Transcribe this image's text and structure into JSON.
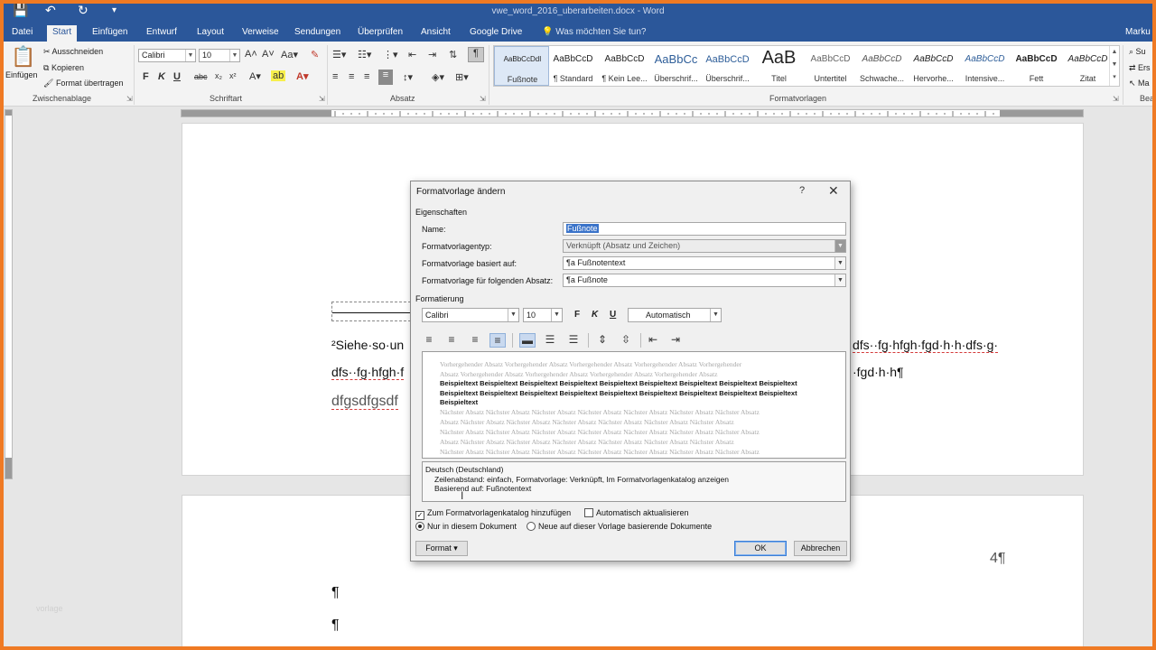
{
  "titlebar": {
    "save_icon": "💾",
    "undo_icon": "↶",
    "redo_icon": "↻",
    "customize_icon": "▾",
    "document_title": "vwe_word_2016_uberarbeiten.docx - Word"
  },
  "tabs": [
    {
      "label": "Datei"
    },
    {
      "label": "Start"
    },
    {
      "label": "Einfügen"
    },
    {
      "label": "Entwurf"
    },
    {
      "label": "Layout"
    },
    {
      "label": "Verweise"
    },
    {
      "label": "Sendungen"
    },
    {
      "label": "Überprüfen"
    },
    {
      "label": "Ansicht"
    },
    {
      "label": "Google Drive"
    },
    {
      "label": "Was möchten Sie tun?"
    },
    {
      "label": "Marku"
    }
  ],
  "ribbon": {
    "clipboard": {
      "paste_label": "Einfügen",
      "cut_label": "Ausschneiden",
      "copy_label": "Kopieren",
      "format_painter_label": "Format übertragen",
      "group_label": "Zwischenablage"
    },
    "font": {
      "font_name": "Calibri",
      "font_size": "10",
      "group_label": "Schriftart"
    },
    "paragraph": {
      "group_label": "Absatz"
    },
    "styles": {
      "group_label": "Formatvorlagen",
      "items": [
        {
          "preview": "AaBbCcDdI",
          "name": "Fußnote"
        },
        {
          "preview": "AaBbCcD",
          "name": "¶ Standard"
        },
        {
          "preview": "AaBbCcD",
          "name": "¶ Kein Lee..."
        },
        {
          "preview": "AaBbCc",
          "name": "Überschrif..."
        },
        {
          "preview": "AaBbCcD",
          "name": "Überschrif..."
        },
        {
          "preview": "AaB",
          "name": "Titel"
        },
        {
          "preview": "AaBbCcD",
          "name": "Untertitel"
        },
        {
          "preview": "AaBbCcD",
          "name": "Schwache..."
        },
        {
          "preview": "AaBbCcD",
          "name": "Hervorhe..."
        },
        {
          "preview": "AaBbCcD",
          "name": "Intensive..."
        },
        {
          "preview": "AaBbCcD",
          "name": "Fett"
        },
        {
          "preview": "AaBbCcD",
          "name": "Zitat"
        }
      ]
    },
    "editing": {
      "search_label": "Su",
      "replace_label": "Ers",
      "select_label": "Ma",
      "group_label": "Bea"
    }
  },
  "document": {
    "line1_start": "²Siehe·so·un",
    "line1_end": "dfs··fg·hfgh·fgd·h·h·dfs·g·",
    "line2_start": "dfs··fg·hfgh·f",
    "line2_end": "·fgd·h·h¶",
    "line3_start": "dfgsdfgsdf",
    "page_number": "4¶",
    "para_mark_1": "¶",
    "para_mark_2": "¶",
    "watermark": "vorlage"
  },
  "dialog": {
    "title": "Formatvorlage ändern",
    "help_label": "?",
    "close_label": "✕",
    "properties_heading": "Eigenschaften",
    "name_label": "Name:",
    "name_value": "Fußnote",
    "type_label": "Formatvorlagentyp:",
    "type_value": "Verknüpft (Absatz und Zeichen)",
    "based_on_label": "Formatvorlage basiert auf:",
    "based_on_value": "¶a Fußnotentext",
    "next_label": "Formatvorlage für folgenden Absatz:",
    "next_value": "¶a Fußnote",
    "formatting_heading": "Formatierung",
    "font_name": "Calibri",
    "font_size": "10",
    "bold_label": "F",
    "italic_label": "K",
    "underline_label": "U",
    "color_value": "Automatisch",
    "preview": {
      "previous": [
        "Vorhergehender Absatz Vorhergehender Absatz Vorhergehender Absatz Vorhergehender Absatz Vorhergehender",
        "Absatz Vorhergehender Absatz Vorhergehender Absatz Vorhergehender Absatz Vorhergehender Absatz"
      ],
      "sample": [
        "Beispieltext Beispieltext Beispieltext Beispieltext Beispieltext Beispieltext Beispieltext Beispieltext Beispieltext",
        "Beispieltext Beispieltext Beispieltext Beispieltext Beispieltext Beispieltext Beispieltext Beispieltext Beispieltext",
        "Beispieltext"
      ],
      "next": [
        "Nächster Absatz Nächster Absatz Nächster Absatz Nächster Absatz Nächster Absatz Nächster Absatz Nächster Absatz",
        "Absatz Nächster Absatz Nächster Absatz Nächster Absatz Nächster Absatz Nächster Absatz Nächster Absatz",
        "Nächster Absatz Nächster Absatz Nächster Absatz Nächster Absatz Nächster Absatz Nächster Absatz Nächster Absatz",
        "Absatz Nächster Absatz Nächster Absatz Nächster Absatz Nächster Absatz Nächster Absatz Nächster Absatz",
        "Nächster Absatz Nächster Absatz Nächster Absatz Nächster Absatz Nächster Absatz Nächster Absatz Nächster Absatz"
      ]
    },
    "description": {
      "line1": "Deutsch (Deutschland)",
      "line2": "Zeilenabstand:  einfach, Formatvorlage: Verknüpft, Im Formatvorlagenkatalog anzeigen",
      "line3": "Basierend auf: Fußnotentext"
    },
    "add_to_gallery_label": "Zum Formatvorlagenkatalog hinzufügen",
    "add_to_gallery_checked": true,
    "auto_update_label": "Automatisch aktualisieren",
    "auto_update_checked": false,
    "only_this_document_label": "Nur in diesem Dokument",
    "new_documents_label": "Neue auf dieser Vorlage basierende Dokumente",
    "format_button_label": "Format ▾",
    "ok_label": "OK",
    "cancel_label": "Abbrechen"
  },
  "colors": {
    "word_blue": "#2b579a",
    "frame_orange": "#ef7a24",
    "selection_blue": "#3a73c9"
  }
}
